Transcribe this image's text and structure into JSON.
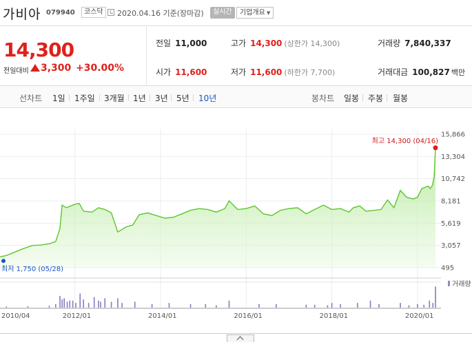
{
  "header": {
    "name": "가비아",
    "code": "079940",
    "market": "코스닥",
    "base_date": "2020.04.16 기준(장마감)",
    "realtime_label": "실시간",
    "company_label": "기업개요"
  },
  "price": {
    "current": "14,300",
    "change_label": "전일대비",
    "change_amount": "3,300",
    "change_percent": "+30.00%"
  },
  "stats": {
    "prev_close": {
      "label": "전일",
      "value": "11,000"
    },
    "high": {
      "label": "고가",
      "value": "14,300",
      "sub": "(상한가 14,300)"
    },
    "volume": {
      "label": "거래량",
      "value": "7,840,337"
    },
    "open": {
      "label": "시가",
      "value": "11,600"
    },
    "low": {
      "label": "저가",
      "value": "11,600",
      "sub": "(하한가 7,700)"
    },
    "amount": {
      "label": "거래대금",
      "value": "100,827",
      "unit": "백만"
    }
  },
  "period_bar": {
    "line_title": "선차트",
    "line_periods": [
      "1일",
      "1주일",
      "3개월",
      "1년",
      "3년",
      "5년",
      "10년"
    ],
    "active_period": "10년",
    "candle_title": "봉차트",
    "candle_periods": [
      "일봉",
      "주봉",
      "월봉"
    ]
  },
  "chart_data": {
    "type": "area",
    "y_ticks": [
      "15,866",
      "13,304",
      "10,742",
      "8,181",
      "5,619",
      "3,057",
      "495"
    ],
    "ylim": [
      495,
      15866
    ],
    "x_ticks": [
      "2010/04",
      "2012/01",
      "2014/01",
      "2016/01",
      "2018/01",
      "2020/01"
    ],
    "x_tick_values": [
      2010.25,
      2012.0,
      2014.0,
      2016.0,
      2018.0,
      2020.0
    ],
    "xlim": [
      2010.25,
      2020.42
    ],
    "max_annotation": "최고 14,300 (04/16)",
    "min_annotation": "최저 1,750 (05/28)",
    "volume_legend": "거래량",
    "x": [
      2010.25,
      2010.4,
      2010.6,
      2010.8,
      2011.0,
      2011.2,
      2011.4,
      2011.55,
      2011.65,
      2011.7,
      2011.8,
      2011.9,
      2012.0,
      2012.1,
      2012.2,
      2012.4,
      2012.55,
      2012.7,
      2012.85,
      2013.0,
      2013.2,
      2013.35,
      2013.5,
      2013.7,
      2013.9,
      2014.1,
      2014.3,
      2014.5,
      2014.7,
      2014.9,
      2015.1,
      2015.3,
      2015.5,
      2015.6,
      2015.8,
      2016.0,
      2016.2,
      2016.4,
      2016.6,
      2016.8,
      2017.0,
      2017.2,
      2017.4,
      2017.6,
      2017.8,
      2018.0,
      2018.2,
      2018.4,
      2018.5,
      2018.65,
      2018.8,
      2019.0,
      2019.15,
      2019.3,
      2019.45,
      2019.6,
      2019.75,
      2019.9,
      2020.0,
      2020.1,
      2020.2,
      2020.25,
      2020.3,
      2020.35,
      2020.39,
      2020.42
    ],
    "values": [
      1750,
      1900,
      2300,
      2700,
      3050,
      3100,
      3250,
      3500,
      5000,
      7700,
      7400,
      7600,
      7800,
      7900,
      7000,
      6900,
      7400,
      7200,
      6800,
      4600,
      5200,
      5400,
      6600,
      6800,
      6500,
      6200,
      6300,
      6700,
      7100,
      7300,
      7200,
      6900,
      7300,
      8200,
      7200,
      7300,
      7600,
      6700,
      6500,
      7100,
      7300,
      7400,
      6700,
      7200,
      7700,
      7200,
      7300,
      6900,
      7400,
      7600,
      7000,
      7100,
      7200,
      8300,
      7400,
      9400,
      8600,
      8400,
      8600,
      9600,
      9800,
      9900,
      9600,
      10000,
      11000,
      14300
    ],
    "volume_x": [
      2010.4,
      2010.9,
      2011.4,
      2011.55,
      2011.65,
      2011.7,
      2011.75,
      2011.82,
      2011.88,
      2011.95,
      2012.02,
      2012.12,
      2012.2,
      2012.32,
      2012.45,
      2012.55,
      2012.6,
      2012.7,
      2012.85,
      2013.0,
      2013.1,
      2013.4,
      2013.8,
      2014.2,
      2014.7,
      2015.05,
      2015.3,
      2015.6,
      2016.3,
      2016.7,
      2017.4,
      2017.6,
      2017.9,
      2018.0,
      2018.2,
      2018.6,
      2018.9,
      2019.1,
      2019.6,
      2019.8,
      2020.0,
      2020.15,
      2020.28,
      2020.36,
      2020.42
    ],
    "volume_values": [
      0.05,
      0.06,
      0.08,
      0.15,
      0.5,
      0.35,
      0.4,
      0.25,
      0.3,
      0.3,
      0.2,
      0.6,
      0.35,
      0.2,
      0.45,
      0.3,
      0.25,
      0.4,
      0.25,
      0.4,
      0.2,
      0.25,
      0.15,
      0.2,
      0.15,
      0.15,
      0.1,
      0.3,
      0.15,
      0.15,
      0.12,
      0.12,
      0.1,
      0.2,
      0.15,
      0.2,
      0.3,
      0.15,
      0.2,
      0.1,
      0.15,
      0.12,
      0.3,
      0.2,
      0.9
    ]
  }
}
